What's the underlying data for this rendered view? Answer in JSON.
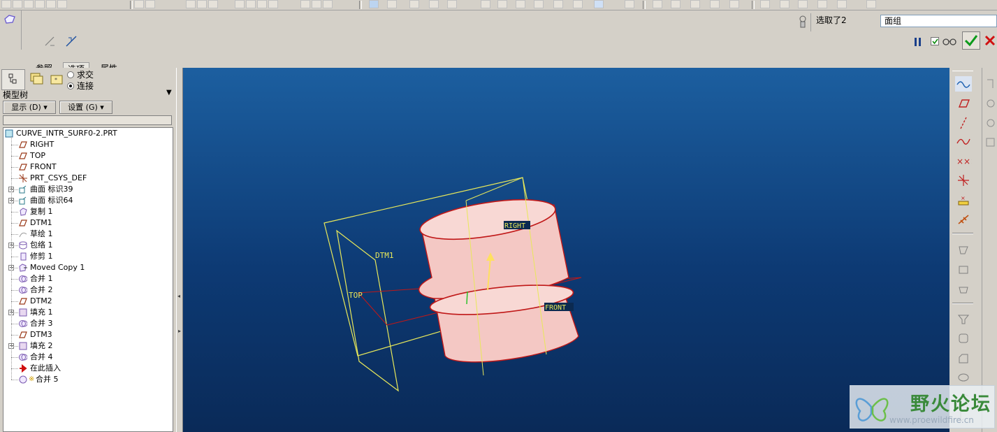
{
  "dashboard": {
    "tabs": [
      {
        "label": "参照"
      },
      {
        "label": "选项",
        "active": true
      },
      {
        "label": "属性"
      }
    ],
    "status_text": "选取了2",
    "filter_value": "面组"
  },
  "left_panel": {
    "radio_options": [
      {
        "label": "求交",
        "checked": false
      },
      {
        "label": "连接",
        "checked": true
      }
    ],
    "title": "模型树",
    "display_button": "显示 (D) ▾",
    "settings_button": "设置 (G) ▾",
    "tree": [
      {
        "label": "CURVE_INTR_SURF0-2.PRT",
        "icon": "part-icon",
        "level": 0,
        "expandable": false
      },
      {
        "label": "RIGHT",
        "icon": "datum-plane-icon",
        "level": 1,
        "expandable": false
      },
      {
        "label": "TOP",
        "icon": "datum-plane-icon",
        "level": 1,
        "expandable": false
      },
      {
        "label": "FRONT",
        "icon": "datum-plane-icon",
        "level": 1,
        "expandable": false
      },
      {
        "label": "PRT_CSYS_DEF",
        "icon": "csys-icon",
        "level": 1,
        "expandable": false
      },
      {
        "label": "曲面 标识39",
        "icon": "surface-icon",
        "level": 1,
        "expandable": true
      },
      {
        "label": "曲面 标识64",
        "icon": "surface-icon",
        "level": 1,
        "expandable": true
      },
      {
        "label": "复制 1",
        "icon": "copy-icon",
        "level": 1,
        "expandable": false
      },
      {
        "label": "DTM1",
        "icon": "datum-plane-icon",
        "level": 1,
        "expandable": false
      },
      {
        "label": "草绘 1",
        "icon": "sketch-icon",
        "level": 1,
        "expandable": false
      },
      {
        "label": "包络 1",
        "icon": "wrap-icon",
        "level": 1,
        "expandable": true
      },
      {
        "label": "修剪 1",
        "icon": "trim-icon",
        "level": 1,
        "expandable": false
      },
      {
        "label": "Moved Copy 1",
        "icon": "moved-copy-icon",
        "level": 1,
        "expandable": true
      },
      {
        "label": "合并 1",
        "icon": "merge-icon",
        "level": 1,
        "expandable": false
      },
      {
        "label": "合并 2",
        "icon": "merge-icon",
        "level": 1,
        "expandable": false
      },
      {
        "label": "DTM2",
        "icon": "datum-plane-icon",
        "level": 1,
        "expandable": false
      },
      {
        "label": "填充 1",
        "icon": "fill-icon",
        "level": 1,
        "expandable": true
      },
      {
        "label": "合并 3",
        "icon": "merge-icon",
        "level": 1,
        "expandable": false
      },
      {
        "label": "DTM3",
        "icon": "datum-plane-icon",
        "level": 1,
        "expandable": false
      },
      {
        "label": "填充 2",
        "icon": "fill-icon",
        "level": 1,
        "expandable": true
      },
      {
        "label": "合并 4",
        "icon": "merge-icon",
        "level": 1,
        "expandable": false
      },
      {
        "label": "在此插入",
        "icon": "insert-arrow-icon",
        "level": 1,
        "expandable": false
      },
      {
        "label": "合并 5",
        "icon": "merge-active-icon",
        "level": 1,
        "expandable": false
      }
    ]
  },
  "viewport": {
    "labels": {
      "dtm1": "DTM1",
      "top": "TOP",
      "right": "RIGHT",
      "front": "FRONT"
    },
    "colors": {
      "background": "#0d3a74",
      "datum": "#e8e85a",
      "surface": "#f4c8c4",
      "edge": "#c01818"
    }
  },
  "watermark": {
    "title": "野火论坛",
    "url": "www.proewildfire.cn"
  }
}
